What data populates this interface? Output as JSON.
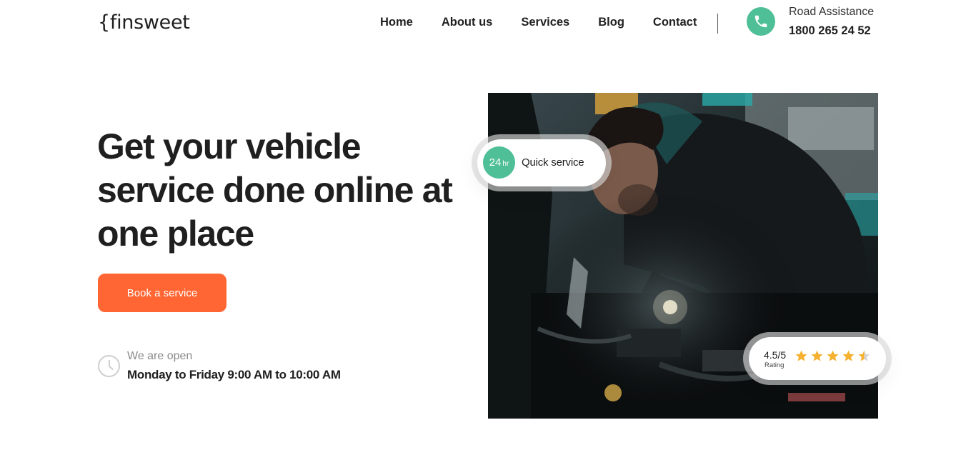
{
  "header": {
    "logo": "{finsweet",
    "nav": [
      "Home",
      "About us",
      "Services",
      "Blog",
      "Contact"
    ],
    "road_assistance_label": "Road Assistance",
    "road_assistance_number": "1800 265 24 52"
  },
  "hero": {
    "title": "Get your vehicle service done online at one place",
    "cta_label": "Book a service",
    "open_label": "We are open",
    "open_hours": "Monday to Friday 9:00 AM to 10:00 AM"
  },
  "badges": {
    "quick_number": "24",
    "quick_unit": "hr",
    "quick_label": "Quick service",
    "rating_value": "4.5/5",
    "rating_label": "Rating",
    "rating_stars": 4.5
  },
  "colors": {
    "accent_orange": "#ff6633",
    "accent_green": "#4fbf98",
    "star_yellow": "#f5b12f"
  },
  "icons": {
    "phone": "phone-icon",
    "clock": "clock-icon",
    "star": "star-icon"
  }
}
